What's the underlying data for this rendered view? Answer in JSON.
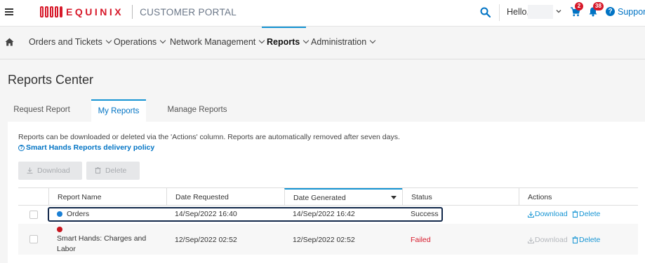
{
  "header": {
    "brand": "EQUINIX",
    "portal": "CUSTOMER PORTAL",
    "greeting": "Hello,",
    "cart_count": "2",
    "notification_count": "38",
    "support_label": "Support",
    "accent": "#1594d3",
    "brand_color": "#d7192a"
  },
  "nav": {
    "items": [
      {
        "label": "Orders and Tickets"
      },
      {
        "label": "Operations"
      },
      {
        "label": "Network Management"
      },
      {
        "label": "Reports"
      },
      {
        "label": "Administration"
      }
    ],
    "active": "Reports"
  },
  "page": {
    "title": "Reports Center",
    "tabs": [
      {
        "label": "Request Report"
      },
      {
        "label": "My Reports"
      },
      {
        "label": "Manage Reports"
      }
    ],
    "active_tab": "My Reports",
    "info": "Reports can be downloaded or deleted via the 'Actions' column. Reports are automatically removed after seven days.",
    "policy_link": "Smart Hands Reports delivery policy",
    "download_button": "Download",
    "delete_button": "Delete"
  },
  "table": {
    "columns": [
      "Report Name",
      "Date Requested",
      "Date Generated",
      "Status",
      "Actions"
    ],
    "sorted_column": "Date Generated",
    "rows": [
      {
        "name": "Orders",
        "dot_color": "#1a7fd4",
        "requested": "14/Sep/2022 16:40",
        "generated": "14/Sep/2022 16:42",
        "status": "Success",
        "download": "Download",
        "delete": "Delete",
        "download_enabled": true
      },
      {
        "name": "Smart Hands: Charges and Labor",
        "dot_color": "#c8161f",
        "requested": "12/Sep/2022 02:52",
        "generated": "12/Sep/2022 02:52",
        "status": "Failed",
        "download": "Download",
        "delete": "Delete",
        "download_enabled": false
      }
    ]
  }
}
